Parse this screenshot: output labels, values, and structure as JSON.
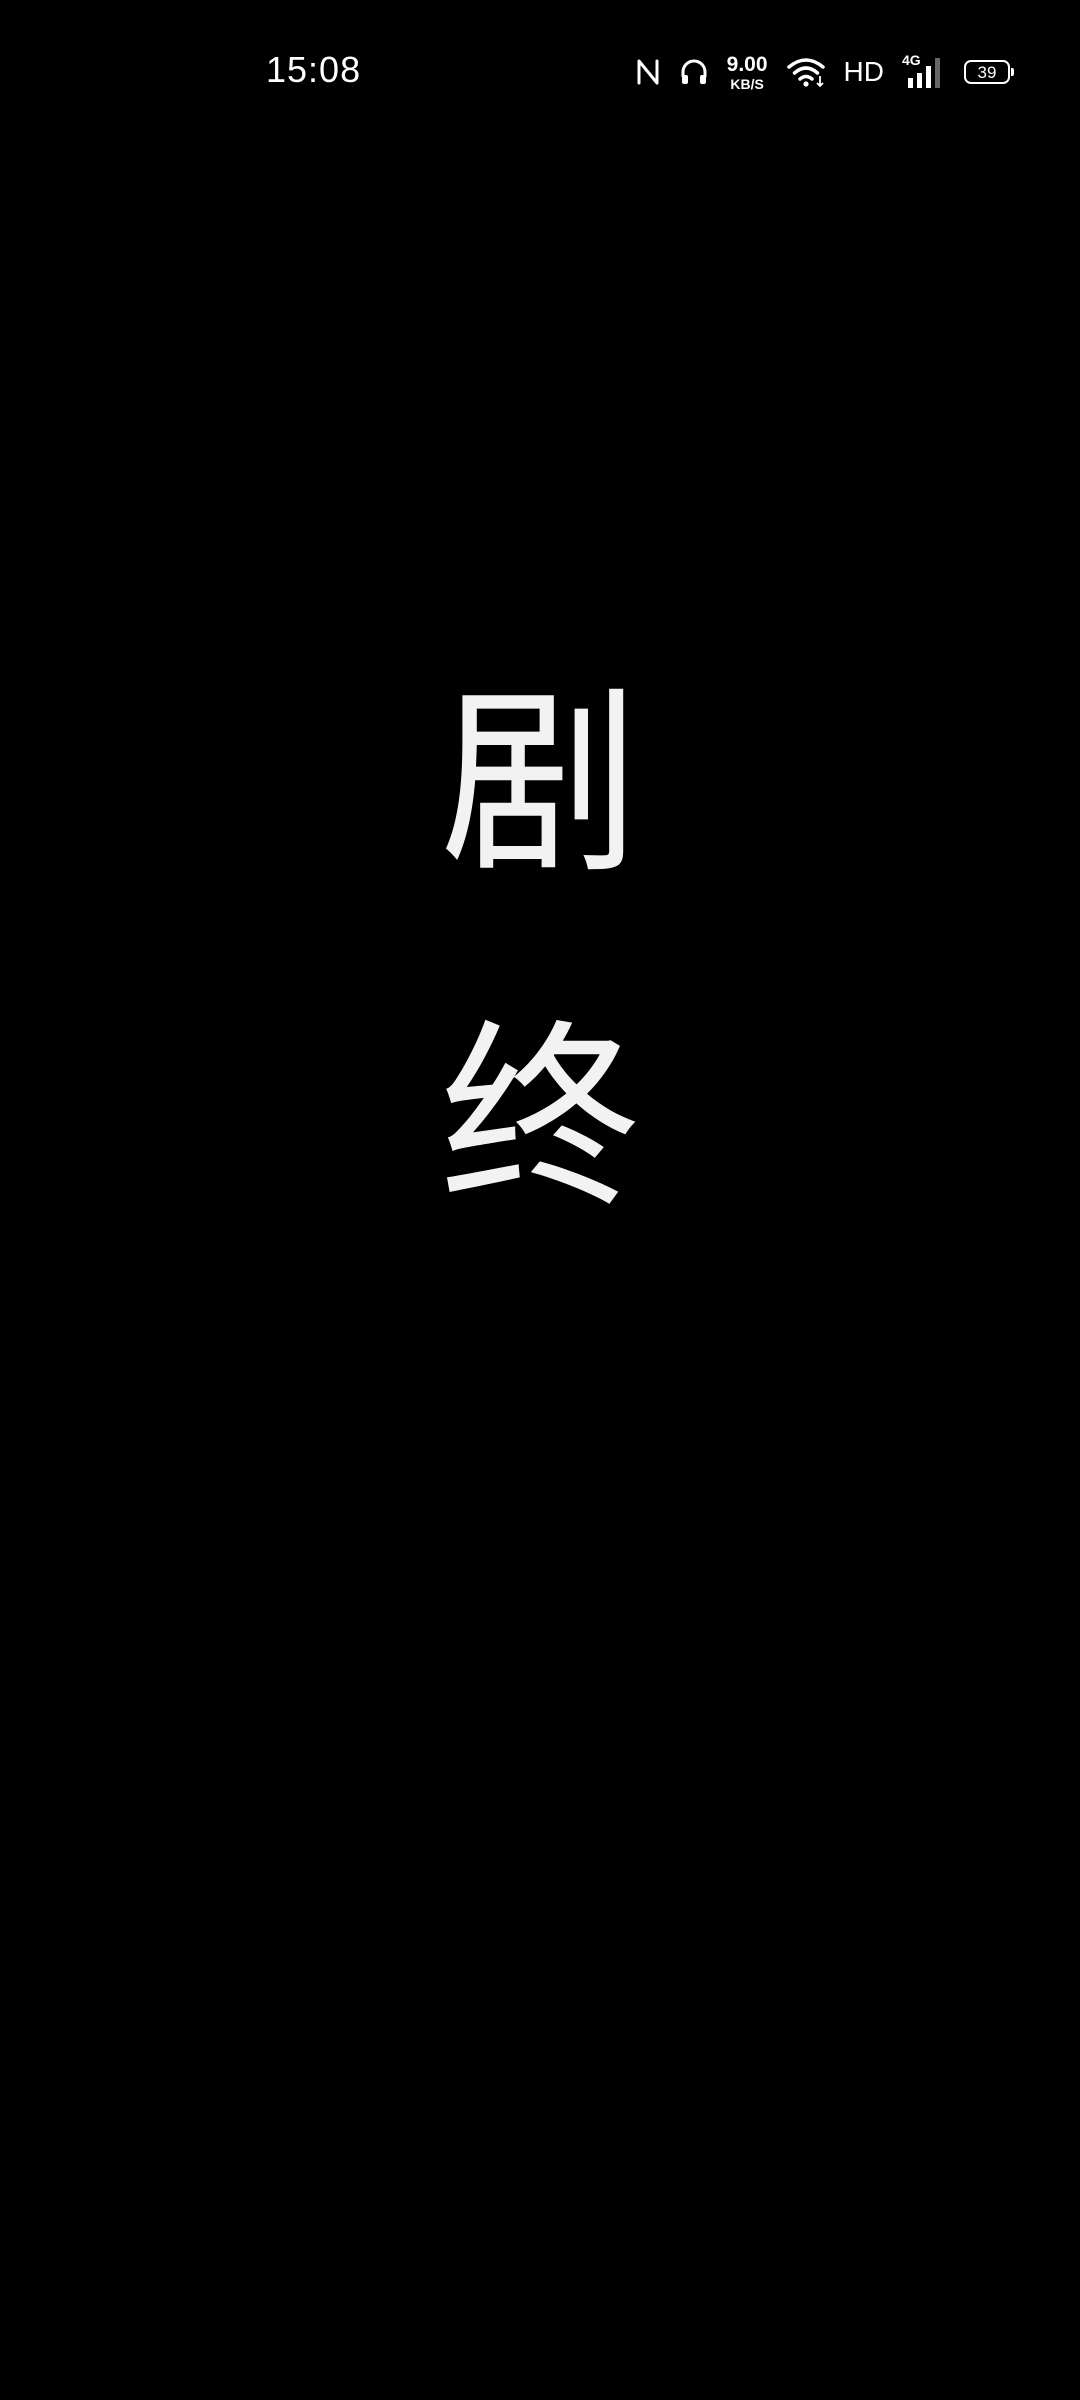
{
  "status_bar": {
    "time": "15:08",
    "net_speed_value": "9.00",
    "net_speed_unit": "KB/S",
    "hd_label": "HD",
    "network_type": "4G",
    "battery_level": "39",
    "icons": [
      "nfc-icon",
      "headset-icon",
      "wifi-icon",
      "cellular-signal-icon",
      "battery-icon"
    ]
  },
  "content": {
    "char_1": "剧",
    "char_2": "终"
  },
  "colors": {
    "background": "#000000",
    "foreground": "#ffffff"
  }
}
